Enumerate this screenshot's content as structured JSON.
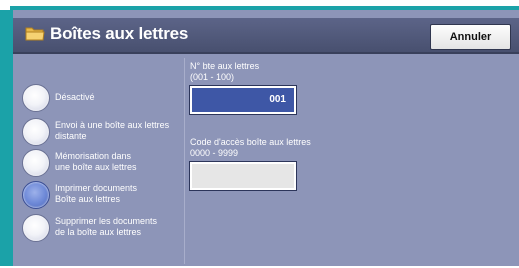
{
  "header": {
    "title": "Boîtes aux lettres",
    "title_icon": "folder-icon",
    "cancel_label": "Annuler"
  },
  "options": [
    {
      "label": "Désactivé",
      "selected": false
    },
    {
      "label": "Envoi à une boîte aux lettres\ndistante",
      "selected": false
    },
    {
      "label": "Mémorisation dans\nune boîte aux lettres",
      "selected": false
    },
    {
      "label": "Imprimer documents\nBoîte aux lettres",
      "selected": true
    },
    {
      "label": "Supprimer les documents\nde la boîte aux lettres",
      "selected": false
    }
  ],
  "mailbox_number": {
    "label": "N° bte aux lettres\n(001 - 100)",
    "value": "001"
  },
  "access_code": {
    "label": "Code d'accès boîte aux lettres\n0000 - 9999",
    "value": ""
  },
  "colors": {
    "accent_teal": "#1ba2a8",
    "panel": "#8d95b8",
    "selected_field": "#3e57a6"
  }
}
